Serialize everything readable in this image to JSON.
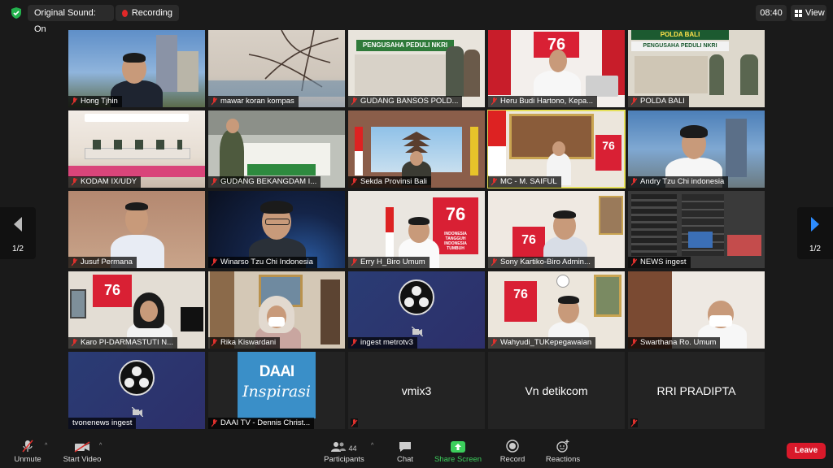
{
  "topbar": {
    "original_sound": "Original Sound: On",
    "recording": "Recording",
    "clock": "08:40",
    "view": "View"
  },
  "pagination": {
    "left": "1/2",
    "right": "1/2"
  },
  "tiles": [
    {
      "name": "Hong Tjhin"
    },
    {
      "name": "mawar koran kompas"
    },
    {
      "name": "GUDANG BANSOS POLD..."
    },
    {
      "name": "Heru Budi Hartono, Kepa..."
    },
    {
      "name": "POLDA BALI"
    },
    {
      "name": "KODAM IX/UDY"
    },
    {
      "name": "GUDANG BEKANGDAM I..."
    },
    {
      "name": "Sekda Provinsi Bali"
    },
    {
      "name": "MC - M. SAIFUL"
    },
    {
      "name": "Andry Tzu Chi indonesia"
    },
    {
      "name": "Jusuf Permana"
    },
    {
      "name": "Winarso Tzu Chi Indonesia"
    },
    {
      "name": "Erry H_Biro Umum"
    },
    {
      "name": "Sony Kartiko-Biro Admin..."
    },
    {
      "name": "NEWS ingest"
    },
    {
      "name": "Karo PI-DARMASTUTI N..."
    },
    {
      "name": "Rika Kiswardani"
    },
    {
      "name": "ingest metrotv3"
    },
    {
      "name": "Wahyudi_TUKepegawaian"
    },
    {
      "name": "Swarthana Ro. Umum"
    },
    {
      "name": "tvonenews ingest"
    },
    {
      "name": "DAAI TV - Dennis Christ..."
    },
    {
      "name": "vmix3"
    },
    {
      "name": "Vn detikcom"
    },
    {
      "name": "RRI PRADIPTA"
    }
  ],
  "tile_text": {
    "banner_pengusaha_1": "PENGUSAHA PEDULI NKRI",
    "banner_pengusaha_2": "PENGUSAHA PEDULI NKRI",
    "banner_polda": "POLDA BALI",
    "logo_76": "76",
    "logo_76_caption": "INDONESIA TANGGUH INDONESIA TUMBUH",
    "daai_line1": "DAAI",
    "daai_line2": "Inspirasi"
  },
  "toolbar": {
    "unmute": "Unmute",
    "start_video": "Start Video",
    "participants": "Participants",
    "participants_count": "44",
    "chat": "Chat",
    "share_screen": "Share Screen",
    "record": "Record",
    "reactions": "Reactions",
    "leave": "Leave"
  },
  "colors": {
    "leave": "#d9192a",
    "share": "#3ccf5c",
    "active_speaker": "#e5e05a",
    "recording": "#e02828"
  }
}
